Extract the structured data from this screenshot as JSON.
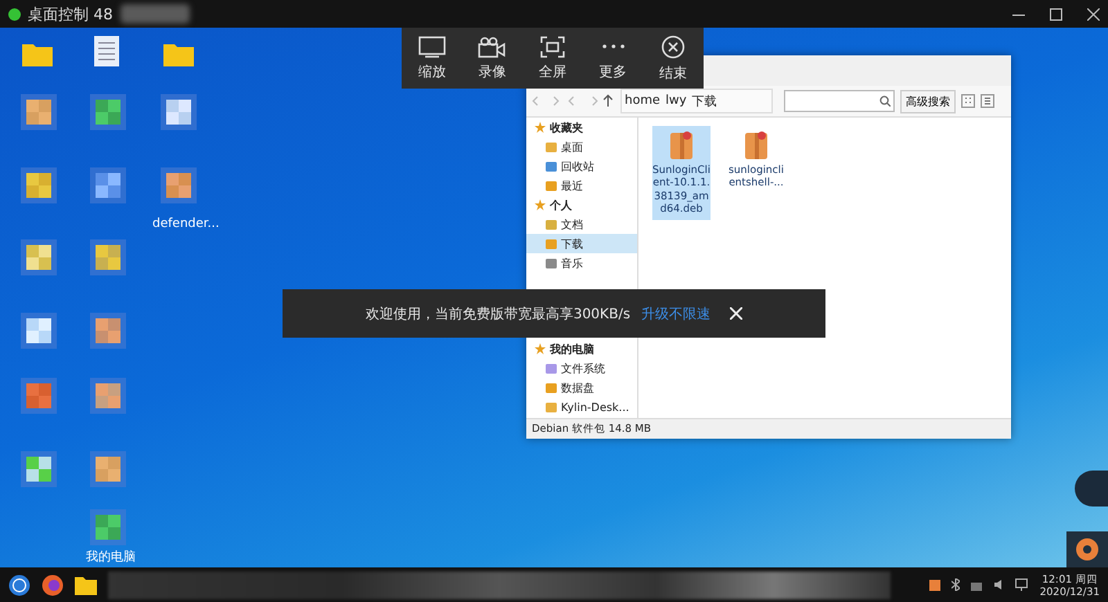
{
  "title_bar": {
    "title": "桌面控制 48"
  },
  "toolbar": [
    {
      "kind": "zoom",
      "label": "缩放"
    },
    {
      "kind": "record",
      "label": "录像"
    },
    {
      "kind": "fullscreen",
      "label": "全屏"
    },
    {
      "kind": "more",
      "label": "更多"
    },
    {
      "kind": "end",
      "label": "结束"
    }
  ],
  "desktop_icons": [
    {
      "label": "defender..."
    },
    {
      "label": "我的电脑"
    }
  ],
  "file_manager": {
    "path": [
      "home",
      "lwy",
      "下载"
    ],
    "search_button": "高级搜索",
    "sidebar": [
      {
        "kind": "header",
        "label": "收藏夹"
      },
      {
        "kind": "item",
        "label": "桌面",
        "selected": false
      },
      {
        "kind": "item",
        "label": "回收站",
        "selected": false
      },
      {
        "kind": "item",
        "label": "最近",
        "selected": false
      },
      {
        "kind": "header",
        "label": "个人"
      },
      {
        "kind": "item",
        "label": "文档",
        "selected": false
      },
      {
        "kind": "item",
        "label": "下载",
        "selected": true
      },
      {
        "kind": "item",
        "label": "音乐",
        "selected": false
      },
      {
        "kind": "covered"
      },
      {
        "kind": "covered"
      },
      {
        "kind": "header",
        "label": "我的电脑"
      },
      {
        "kind": "item",
        "label": "文件系统",
        "selected": false
      },
      {
        "kind": "item",
        "label": "数据盘",
        "selected": false
      },
      {
        "kind": "item",
        "label": "Kylin-Desk...",
        "selected": false
      }
    ],
    "files": [
      {
        "name": "SunloginClient-10.1.1.38139_amd64.deb",
        "selected": true
      },
      {
        "name": "sunloginclientshell-...",
        "selected": false
      }
    ],
    "status": "Debian 软件包 14.8 MB"
  },
  "notice": {
    "message": "欢迎使用，当前免费版带宽最高享300KB/s",
    "link": "升级不限速"
  },
  "clock": {
    "time": "12:01 周四",
    "date": "2020/12/31"
  }
}
